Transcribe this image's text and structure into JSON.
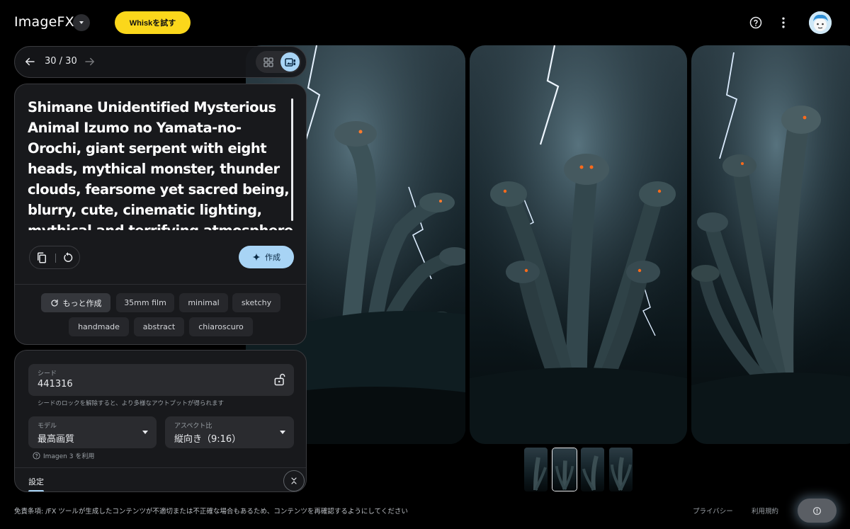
{
  "header": {
    "app_name": "ImageFX",
    "whisk_label": "Whiskを試す"
  },
  "nav": {
    "counter": "30 / 30"
  },
  "prompt": {
    "text": "Shimane Unidentified Mysterious Animal Izumo no Yamata-no-Orochi, giant serpent with eight heads, mythical monster, thunder clouds, fearsome yet sacred being, blurry, cute, cinematic lighting, mythical and terrifying atmosphere",
    "create_label": "作成"
  },
  "chips": {
    "more": "もっと作成",
    "items": [
      "35mm film",
      "minimal",
      "sketchy",
      "handmade",
      "abstract",
      "chiaroscuro"
    ]
  },
  "settings": {
    "seed_label": "シード",
    "seed_value": "441316",
    "seed_help": "シードのロックを解除すると、より多様なアウトプットが得られます",
    "model_label": "モデル",
    "model_value": "最高画質",
    "aspect_label": "アスペクト比",
    "aspect_value": "縦向き（9:16）",
    "imagen_note": "Imagen 3 を利用",
    "settings_label": "設定"
  },
  "footer": {
    "disclaimer": "免責条項: /FX ツールが生成したコンテンツが不適切または不正確な場合もあるため、コンテンツを再確認するようにしてください",
    "privacy": "プライバシー",
    "terms": "利用規約"
  },
  "colors": {
    "whisk_yellow": "#fbd71b",
    "accent_blue": "#a8d4f5",
    "panel_bg": "#18191c",
    "field_bg": "#2a2b2f"
  }
}
